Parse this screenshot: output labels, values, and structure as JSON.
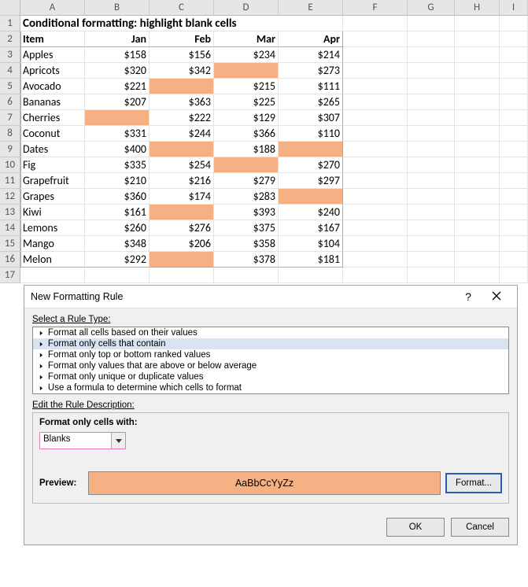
{
  "columns": [
    "",
    "A",
    "B",
    "C",
    "D",
    "E",
    "F",
    "G",
    "H",
    "I"
  ],
  "title": "Conditional formatting: highlight blank cells",
  "headers": [
    "Item",
    "Jan",
    "Feb",
    "Mar",
    "Apr"
  ],
  "rows": [
    {
      "item": "Apples",
      "vals": [
        "$158",
        "$156",
        "$234",
        "$214"
      ],
      "blanks": []
    },
    {
      "item": "Apricots",
      "vals": [
        "$320",
        "$342",
        "",
        "$273"
      ],
      "blanks": [
        2
      ]
    },
    {
      "item": "Avocado",
      "vals": [
        "$221",
        "",
        "$215",
        "$111"
      ],
      "blanks": [
        1
      ]
    },
    {
      "item": "Bananas",
      "vals": [
        "$207",
        "$363",
        "$225",
        "$265"
      ],
      "blanks": []
    },
    {
      "item": "Cherries",
      "vals": [
        "",
        "$222",
        "$129",
        "$307"
      ],
      "blanks": [
        0
      ]
    },
    {
      "item": "Coconut",
      "vals": [
        "$331",
        "$244",
        "$366",
        "$110"
      ],
      "blanks": []
    },
    {
      "item": "Dates",
      "vals": [
        "$400",
        "",
        "$188",
        ""
      ],
      "blanks": [
        1,
        3
      ]
    },
    {
      "item": "Fig",
      "vals": [
        "$335",
        "$254",
        "",
        "$270"
      ],
      "blanks": [
        2
      ]
    },
    {
      "item": "Grapefruit",
      "vals": [
        "$210",
        "$216",
        "$279",
        "$297"
      ],
      "blanks": []
    },
    {
      "item": "Grapes",
      "vals": [
        "$360",
        "$174",
        "$283",
        ""
      ],
      "blanks": [
        3
      ]
    },
    {
      "item": "Kiwi",
      "vals": [
        "$161",
        "",
        "$393",
        "$240"
      ],
      "blanks": [
        1
      ]
    },
    {
      "item": "Lemons",
      "vals": [
        "$260",
        "$276",
        "$375",
        "$167"
      ],
      "blanks": []
    },
    {
      "item": "Mango",
      "vals": [
        "$348",
        "$206",
        "$358",
        "$104"
      ],
      "blanks": []
    },
    {
      "item": "Melon",
      "vals": [
        "$292",
        "",
        "$378",
        "$181"
      ],
      "blanks": [
        1
      ]
    }
  ],
  "dialog": {
    "title": "New Formatting Rule",
    "select_label": "Select a Rule Type:",
    "rule_types": [
      "Format all cells based on their values",
      "Format only cells that contain",
      "Format only top or bottom ranked values",
      "Format only values that are above or below average",
      "Format only unique or duplicate values",
      "Use a formula to determine which cells to format"
    ],
    "selected_rule": 1,
    "edit_label": "Edit the Rule Description:",
    "desc_label": "Format only cells with:",
    "combo_value": "Blanks",
    "preview_label": "Preview:",
    "preview_text": "AaBbCcYyZz",
    "format_btn": "Format...",
    "ok": "OK",
    "cancel": "Cancel"
  },
  "chart_data": {
    "type": "table",
    "title": "Conditional formatting: highlight blank cells",
    "columns": [
      "Item",
      "Jan",
      "Feb",
      "Mar",
      "Apr"
    ],
    "data": [
      [
        "Apples",
        158,
        156,
        234,
        214
      ],
      [
        "Apricots",
        320,
        342,
        null,
        273
      ],
      [
        "Avocado",
        221,
        null,
        215,
        111
      ],
      [
        "Bananas",
        207,
        363,
        225,
        265
      ],
      [
        "Cherries",
        null,
        222,
        129,
        307
      ],
      [
        "Coconut",
        331,
        244,
        366,
        110
      ],
      [
        "Dates",
        400,
        null,
        188,
        null
      ],
      [
        "Fig",
        335,
        254,
        null,
        270
      ],
      [
        "Grapefruit",
        210,
        216,
        279,
        297
      ],
      [
        "Grapes",
        360,
        174,
        283,
        null
      ],
      [
        "Kiwi",
        161,
        null,
        393,
        240
      ],
      [
        "Lemons",
        260,
        276,
        375,
        167
      ],
      [
        "Mango",
        348,
        206,
        358,
        104
      ],
      [
        "Melon",
        292,
        null,
        378,
        181
      ]
    ]
  }
}
